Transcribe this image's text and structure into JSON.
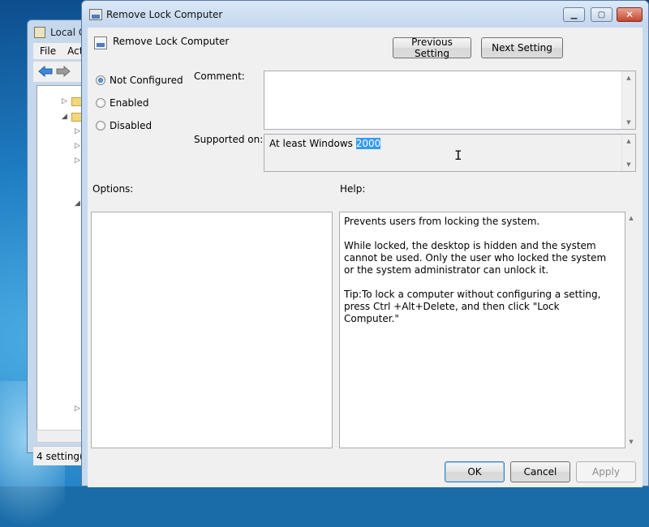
{
  "background_window": {
    "title": "Local G",
    "menu": [
      "File",
      "Act"
    ],
    "status": "4 setting(s"
  },
  "dialog": {
    "title": "Remove Lock Computer",
    "header_title": "Remove Lock Computer",
    "previous_label": "Previous Setting",
    "next_label": "Next Setting",
    "radio": {
      "not_configured": "Not Configured",
      "enabled": "Enabled",
      "disabled": "Disabled",
      "selected": "not_configured"
    },
    "comment_label": "Comment:",
    "comment_value": "",
    "supported_label": "Supported on:",
    "supported_prefix": "At least Windows ",
    "supported_selected": "2000",
    "options_label": "Options:",
    "help_label": "Help:",
    "help_paragraphs": [
      "Prevents users from locking the system.",
      "While locked, the desktop is hidden and the system cannot be used. Only the user who locked the system or the system administrator can unlock it.",
      "Tip:To lock a computer without configuring a setting, press Ctrl +Alt+Delete, and then click \"Lock Computer.\""
    ],
    "ok_label": "OK",
    "cancel_label": "Cancel",
    "apply_label": "Apply"
  },
  "colors": {
    "selection": "#3399ff",
    "dialog_frame": "#c6d9ee",
    "close_button": "#c6452c"
  }
}
